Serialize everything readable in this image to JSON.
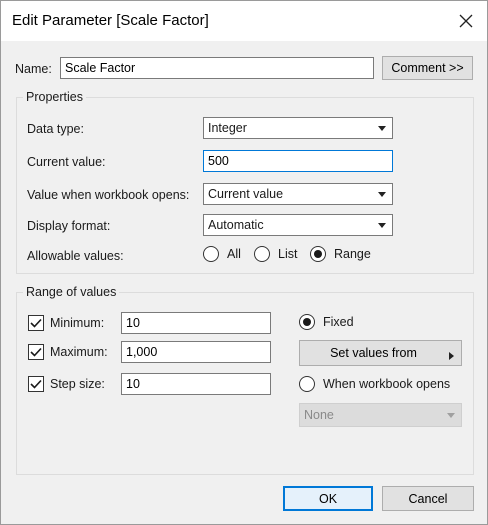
{
  "window": {
    "title": "Edit Parameter [Scale Factor]"
  },
  "name_row": {
    "label": "Name:",
    "value": "Scale Factor",
    "comment_button": "Comment >>"
  },
  "properties": {
    "group_title": "Properties",
    "data_type": {
      "label": "Data type:",
      "value": "Integer"
    },
    "current_value": {
      "label": "Current value:",
      "value": "500"
    },
    "when_opens": {
      "label": "Value when workbook opens:",
      "value": "Current value"
    },
    "display_format": {
      "label": "Display format:",
      "value": "Automatic"
    },
    "allowable": {
      "label": "Allowable values:",
      "options": [
        "All",
        "List",
        "Range"
      ],
      "selected": "Range"
    }
  },
  "range": {
    "group_title": "Range of values",
    "minimum": {
      "label": "Minimum:",
      "value": "10",
      "checked": true
    },
    "maximum": {
      "label": "Maximum:",
      "value": "1,000",
      "checked": true
    },
    "step": {
      "label": "Step size:",
      "value": "10",
      "checked": true
    },
    "fixed_label": "Fixed",
    "set_values_button": "Set values from",
    "when_opens_label": "When workbook opens",
    "source_dropdown": "None",
    "selected_mode": "Fixed"
  },
  "footer": {
    "ok": "OK",
    "cancel": "Cancel"
  }
}
